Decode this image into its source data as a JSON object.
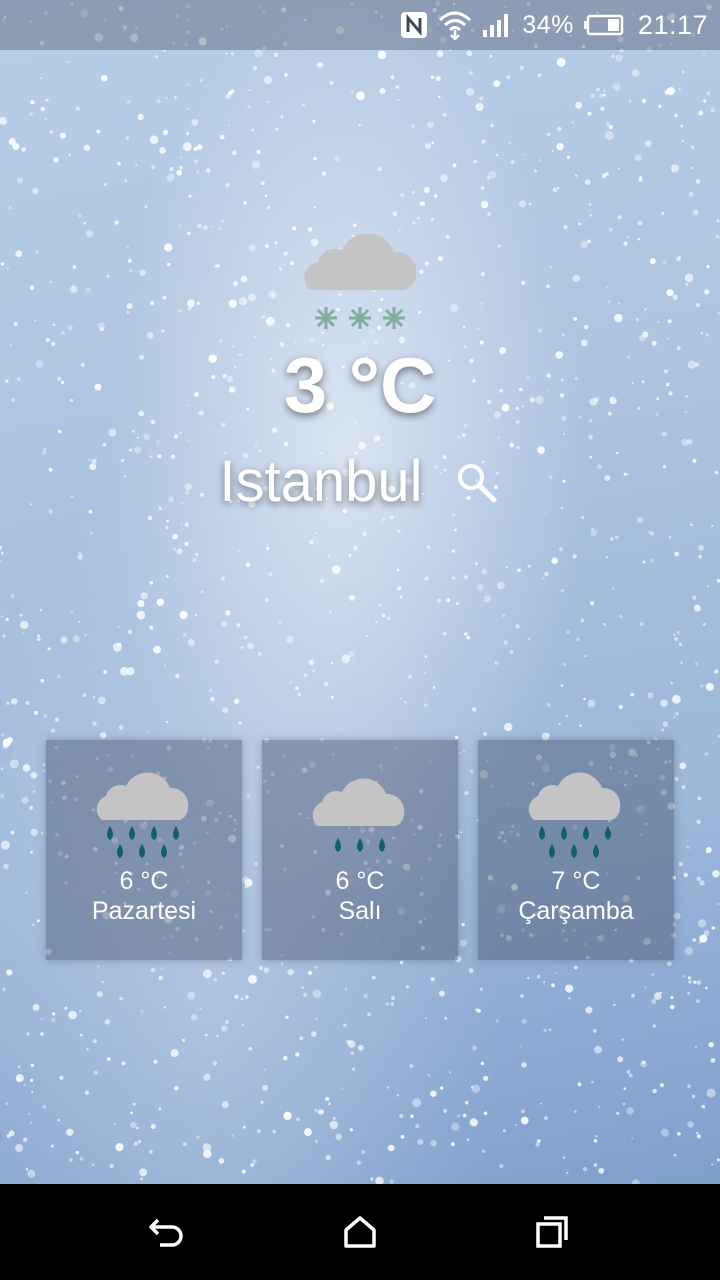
{
  "status_bar": {
    "battery": "34%",
    "time": "21:17",
    "icons": [
      "nfc-icon",
      "wifi-icon",
      "signal-icon",
      "battery-icon"
    ]
  },
  "current": {
    "icon": "cloud-snow-icon",
    "temperature": "3 °C",
    "city": "Istanbul"
  },
  "forecast": [
    {
      "icon": "cloud-heavy-rain-icon",
      "temperature": "6  °C",
      "day": "Pazartesi"
    },
    {
      "icon": "cloud-light-rain-icon",
      "temperature": "6  °C",
      "day": "Salı"
    },
    {
      "icon": "cloud-heavy-rain-icon",
      "temperature": "7  °C",
      "day": "Çarşamba"
    }
  ],
  "nav_bar": {
    "icons": [
      "back-icon",
      "home-icon",
      "recents-icon"
    ]
  },
  "colors": {
    "cloud": "#c4c4c4",
    "snowflake": "#7fae9a",
    "raindrop": "#0f5f6e",
    "text": "#ffffff"
  }
}
